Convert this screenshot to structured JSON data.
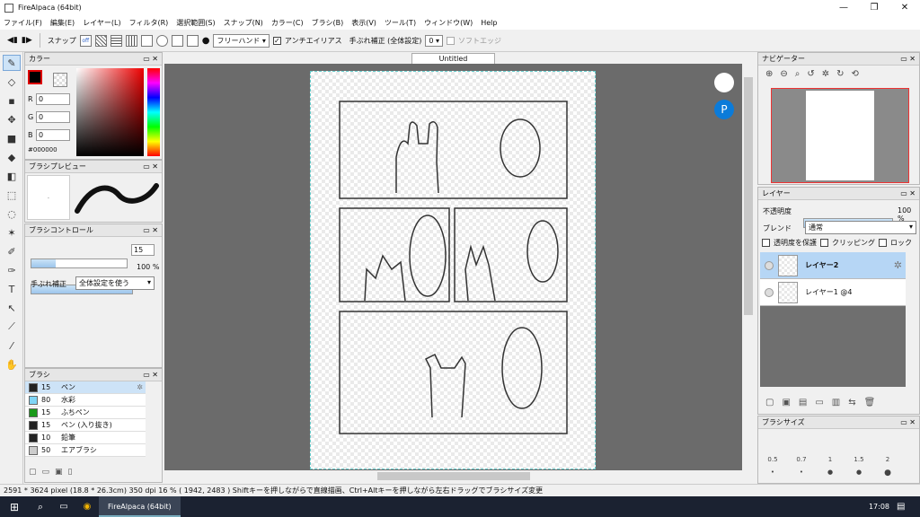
{
  "window": {
    "title": "FireAlpaca (64bit)",
    "controls": [
      "—",
      "❐",
      "✕"
    ]
  },
  "menu": [
    "ファイル(F)",
    "編集(E)",
    "レイヤー(L)",
    "フィルタ(R)",
    "選択範囲(S)",
    "スナップ(N)",
    "カラー(C)",
    "ブラシ(B)",
    "表示(V)",
    "ツール(T)",
    "ウィンドウ(W)",
    "Help"
  ],
  "toolbar": {
    "snap_label": "スナップ",
    "snap_off": "off",
    "stroke_mode": "フリーハンド",
    "antialias_label": "アンチエイリアス",
    "stabilizer_label": "手ぶれ補正 (全体設定)",
    "stabilizer_value": "0",
    "soft_edge_label": "ソフトエッジ"
  },
  "color_panel": {
    "title": "カラー",
    "r": "0",
    "g": "0",
    "b": "0",
    "hex": "#000000",
    "r_label": "R",
    "g_label": "G",
    "b_label": "B"
  },
  "brush_preview": {
    "title": "ブラシプレビュー"
  },
  "brush_control": {
    "title": "ブラシコントロール",
    "size": "15",
    "opacity": "100 %",
    "size_fill": 0.25,
    "opacity_fill": 1.0,
    "stabilizer_label": "手ぶれ補正",
    "stabilizer_value": "全体設定を使う"
  },
  "brush_panel": {
    "title": "ブラシ",
    "items": [
      {
        "size": "15",
        "name": "ペン",
        "color": "#222222"
      },
      {
        "size": "80",
        "name": "水彩",
        "color": "#7fd4f5"
      },
      {
        "size": "15",
        "name": "ふちペン",
        "color": "#1a9a1a"
      },
      {
        "size": "15",
        "name": "ペン (入り抜き)",
        "color": "#222222"
      },
      {
        "size": "10",
        "name": "鉛筆",
        "color": "#222222"
      },
      {
        "size": "50",
        "name": "エアブラシ",
        "color": "#cccccc"
      }
    ]
  },
  "document": {
    "tab": "Untitled"
  },
  "navigator": {
    "title": "ナビゲーター"
  },
  "layer_panel": {
    "title": "レイヤー",
    "opacity_label": "不透明度",
    "opacity_value": "100 %",
    "blend_label": "ブレンド",
    "blend_value": "通常",
    "protect_alpha": "透明度を保護",
    "clipping": "クリッピング",
    "lock": "ロック",
    "layers": [
      {
        "name": "レイヤー2",
        "selected": true
      },
      {
        "name": "レイヤー1 @4",
        "selected": false
      }
    ]
  },
  "brush_size_panel": {
    "title": "ブラシサイズ",
    "sizes": [
      "0.5",
      "0.7",
      "1",
      "1.5",
      "2"
    ]
  },
  "status": {
    "text": "2591 * 3624 pixel  (18.8 * 26.3cm)  350 dpi  16 %  ( 1942, 2483 )  Shiftキーを押しながらで直線描画、Ctrl+Altキーを押しながら左右ドラッグでブラシサイズ変更"
  },
  "taskbar": {
    "app_label": "FireAlpaca (64bit)",
    "time": "17:08"
  },
  "colors": {
    "accent": "#cde3f7",
    "canvas_bg": "#6b6b6b",
    "taskbar": "#1b2231"
  }
}
